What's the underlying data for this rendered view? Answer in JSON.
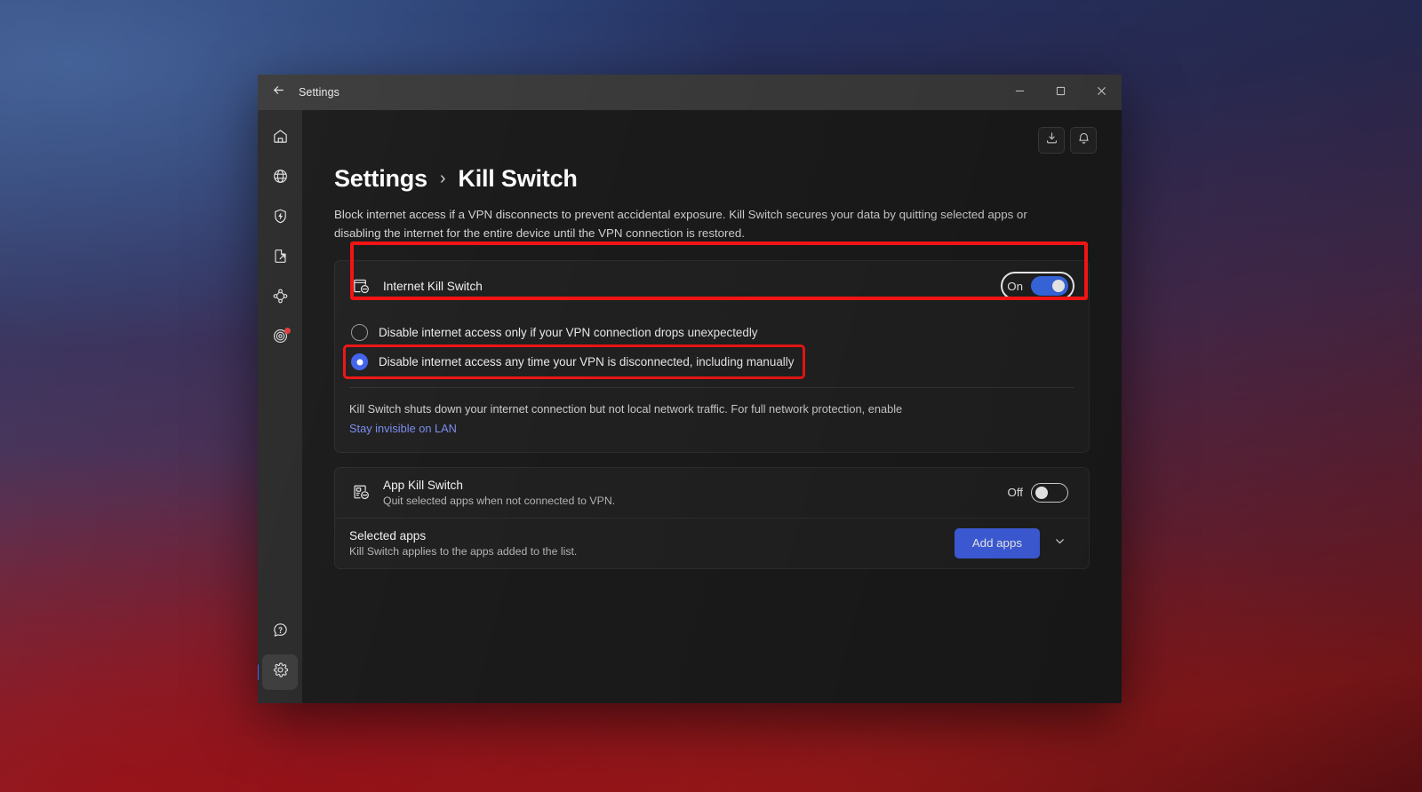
{
  "window": {
    "titlebar": {
      "back_icon": "arrow-left-icon",
      "title": "Settings",
      "minimize_icon": "minimize-icon",
      "maximize_icon": "maximize-icon",
      "close_icon": "close-icon"
    },
    "sidebar": {
      "items": [
        {
          "name": "home",
          "icon": "home-icon",
          "badge": false,
          "active": false
        },
        {
          "name": "locations",
          "icon": "globe-icon",
          "badge": false,
          "active": false
        },
        {
          "name": "threat-protection",
          "icon": "shield-bolt-icon",
          "badge": false,
          "active": false
        },
        {
          "name": "file-share",
          "icon": "file-share-icon",
          "badge": false,
          "active": false
        },
        {
          "name": "meshnet",
          "icon": "meshnet-icon",
          "badge": false,
          "active": false
        },
        {
          "name": "dark-web-monitor",
          "icon": "target-icon",
          "badge": true,
          "active": false
        }
      ],
      "bottom_items": [
        {
          "name": "help",
          "icon": "help-bubble-icon",
          "badge": false,
          "active": false
        },
        {
          "name": "settings",
          "icon": "gear-icon",
          "badge": false,
          "active": true
        }
      ]
    },
    "content_actions": [
      {
        "name": "downloads",
        "icon": "download-icon"
      },
      {
        "name": "notifications",
        "icon": "bell-icon"
      }
    ]
  },
  "page": {
    "breadcrumb_root": "Settings",
    "breadcrumb_separator": "›",
    "breadcrumb_current": "Kill Switch",
    "description": "Block internet access if a VPN disconnects to prevent accidental exposure. Kill Switch secures your data by quitting selected apps or disabling the internet for the entire device until the VPN connection is restored."
  },
  "internet_kill_switch": {
    "icon": "monitor-block-icon",
    "title": "Internet Kill Switch",
    "toggle_state_label": "On",
    "toggle_on": true,
    "options": [
      {
        "label": "Disable internet access only if your VPN connection drops unexpectedly",
        "checked": false,
        "highlighted": false
      },
      {
        "label": "Disable internet access any time your VPN is disconnected, including manually",
        "checked": true,
        "highlighted": true
      }
    ],
    "note_text": "Kill Switch shuts down your internet connection but not local network traffic. For full network protection, enable",
    "note_link": "Stay invisible on LAN"
  },
  "app_kill_switch": {
    "icon": "app-block-icon",
    "title": "App Kill Switch",
    "subtitle": "Quit selected apps when not connected to VPN.",
    "toggle_state_label": "Off",
    "toggle_on": false,
    "selected_apps": {
      "title": "Selected apps",
      "subtitle": "Kill Switch applies to the apps added to the list.",
      "add_button_label": "Add apps",
      "expand_icon": "chevron-down-icon"
    }
  },
  "colors": {
    "accent_blue": "#4263eb",
    "toggle_on_blue": "#3c6ef0",
    "annotation_red": "#f21414",
    "link_blue": "#7b8cf0",
    "badge_red": "#e23b3b"
  }
}
